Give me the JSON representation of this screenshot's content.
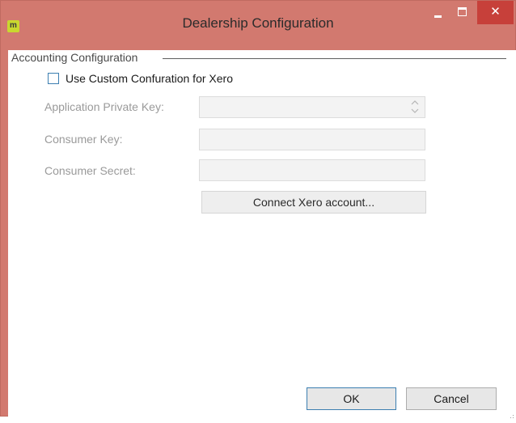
{
  "window": {
    "title": "Dealership Configuration",
    "app_icon_label": "m",
    "minimize_icon": "minimize-icon",
    "maximize_icon": "maximize-icon",
    "close_label": "✕"
  },
  "accounting": {
    "group_title": "Accounting Configuration",
    "use_custom_label": "Use Custom Confuration for Xero",
    "use_custom_checked": false,
    "fields": {
      "private_key_label": "Application Private Key:",
      "private_key_value": "",
      "consumer_key_label": "Consumer Key:",
      "consumer_key_value": "",
      "consumer_secret_label": "Consumer Secret:",
      "consumer_secret_value": ""
    },
    "connect_button": "Connect Xero account..."
  },
  "buttons": {
    "ok": "OK",
    "cancel": "Cancel"
  },
  "colors": {
    "titlebar": "#d2796f",
    "close_button": "#c7403a",
    "app_icon": "#c9d82f",
    "focus_border": "#3c7fb1",
    "disabled_text": "#9a9a9a"
  }
}
